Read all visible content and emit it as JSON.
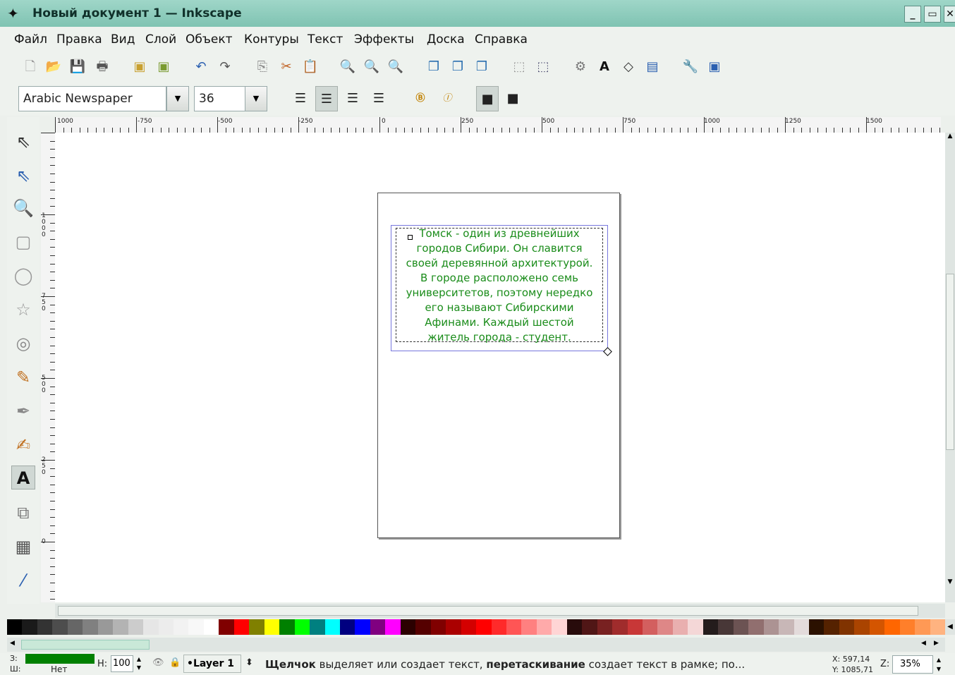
{
  "window": {
    "title": "Новый документ 1 — Inkscape",
    "min": "_",
    "max": "▭",
    "close": "✕"
  },
  "menu": [
    "Файл",
    "Правка",
    "Вид",
    "Слой",
    "Объект",
    "Контуры",
    "Текст",
    "Эффекты",
    "Доска",
    "Справка"
  ],
  "text_toolbar": {
    "font_family": "Arabic Newspaper",
    "font_size": "36"
  },
  "ruler": {
    "h_labels": [
      "1000",
      "-750",
      "-500",
      "-250",
      "0",
      "250",
      "500",
      "750",
      "1000",
      "1250",
      "1500"
    ],
    "v_labels": [
      "1000",
      "750",
      "500",
      "250",
      "0"
    ]
  },
  "canvas_text": [
    "Томск - один из древнейших",
    "городов Сибири. Он славится",
    "своей деревянной архитектурой.",
    "В городе расположено семь",
    "университетов, поэтому нередко",
    "его называют Сибирскими",
    "Афинами. Каждый шестой",
    "житель города - студент."
  ],
  "palette": [
    "#000000",
    "#1a1a1a",
    "#333333",
    "#4d4d4d",
    "#666666",
    "#808080",
    "#999999",
    "#b3b3b3",
    "#cccccc",
    "#e6e6e6",
    "#ececec",
    "#f2f2f2",
    "#f8f8f8",
    "#ffffff",
    "#800000",
    "#ff0000",
    "#808000",
    "#ffff00",
    "#008000",
    "#00ff00",
    "#008080",
    "#00ffff",
    "#000080",
    "#0000ff",
    "#800080",
    "#ff00ff",
    "#2b0000",
    "#550000",
    "#800000",
    "#aa0000",
    "#d40000",
    "#ff0000",
    "#ff2a2a",
    "#ff5555",
    "#ff8080",
    "#ffaaaa",
    "#ffd5d5",
    "#280b0b",
    "#501616",
    "#782121",
    "#a02c2c",
    "#c83737",
    "#d35f5f",
    "#de8787",
    "#e9afaf",
    "#f4d7d7",
    "#241c1c",
    "#483737",
    "#6c5353",
    "#916f6f",
    "#ac9393",
    "#c8b7b7",
    "#e3dbdb",
    "#2b1100",
    "#552200",
    "#803300",
    "#aa4400",
    "#d45500",
    "#ff6600",
    "#ff7f2a",
    "#ff9955",
    "#ffb380"
  ],
  "status": {
    "fill_label": "З:",
    "stroke_label": "Ш:",
    "stroke_value": "Нет",
    "fill_color": "#008000",
    "h_label": "Н:",
    "h_value": "100",
    "layer": "•Layer 1",
    "message_bold1": "Щелчок",
    "message_1": " выделяет или создает текст, ",
    "message_bold2": "перетаскивание",
    "message_2": " создает текст в рамке; по...",
    "x_coord": "X: 597,14",
    "y_coord": "Y: 1085,71",
    "zoom_label": "Z:",
    "zoom": "35%"
  }
}
